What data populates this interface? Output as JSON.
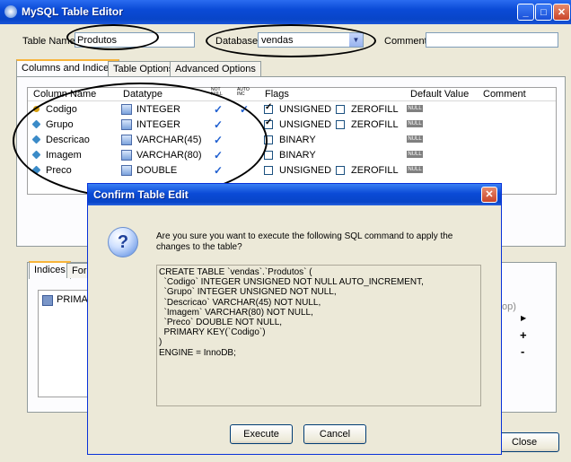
{
  "window": {
    "title": "MySQL Table Editor"
  },
  "form": {
    "table_name_label": "Table Name:",
    "table_name_value": "Produtos",
    "database_label": "Database:",
    "database_value": "vendas",
    "comment_label": "Comment:"
  },
  "tabs": [
    "Columns and Indices",
    "Table Options",
    "Advanced Options"
  ],
  "columns": {
    "headers": {
      "name": "Column Name",
      "datatype": "Datatype",
      "not_null": "NOT NULL",
      "auto_inc": "AUTO INC",
      "flags": "Flags",
      "default": "Default Value",
      "comment": "Comment"
    },
    "rows": [
      {
        "name": "Codigo",
        "type": "INTEGER",
        "not_null": true,
        "auto_inc": true,
        "flag1": "UNSIGNED",
        "flag1_checked": true,
        "flag2": "ZEROFILL",
        "flag2_checked": false,
        "key": true
      },
      {
        "name": "Grupo",
        "type": "INTEGER",
        "not_null": true,
        "auto_inc": false,
        "flag1": "UNSIGNED",
        "flag1_checked": true,
        "flag2": "ZEROFILL",
        "flag2_checked": false,
        "key": false
      },
      {
        "name": "Descricao",
        "type": "VARCHAR(45)",
        "not_null": true,
        "auto_inc": false,
        "flag1": "BINARY",
        "flag1_checked": false,
        "flag2": "",
        "flag2_checked": false,
        "key": false
      },
      {
        "name": "Imagem",
        "type": "VARCHAR(80)",
        "not_null": true,
        "auto_inc": false,
        "flag1": "BINARY",
        "flag1_checked": false,
        "flag2": "",
        "flag2_checked": false,
        "key": false
      },
      {
        "name": "Preco",
        "type": "DOUBLE",
        "not_null": true,
        "auto_inc": false,
        "flag1": "UNSIGNED",
        "flag1_checked": false,
        "flag2": "ZEROFILL",
        "flag2_checked": false,
        "key": false
      }
    ],
    "null_badge": "NULL"
  },
  "lower_tabs": [
    "Indices",
    "Fore"
  ],
  "index_item": "PRIMAR",
  "index_side_text": "op)",
  "index_buttons": [
    "+",
    "-"
  ],
  "close_button": "Close",
  "dialog": {
    "title": "Confirm Table Edit",
    "question": "Are you sure you want to execute the following SQL command to apply the changes to the table?",
    "sql": "CREATE TABLE `vendas`.`Produtos` (\n  `Codigo` INTEGER UNSIGNED NOT NULL AUTO_INCREMENT,\n  `Grupo` INTEGER UNSIGNED NOT NULL,\n  `Descricao` VARCHAR(45) NOT NULL,\n  `Imagem` VARCHAR(80) NOT NULL,\n  `Preco` DOUBLE NOT NULL,\n  PRIMARY KEY(`Codigo`)\n)\nENGINE = InnoDB;",
    "execute_button": "Execute",
    "cancel_button": "Cancel"
  }
}
